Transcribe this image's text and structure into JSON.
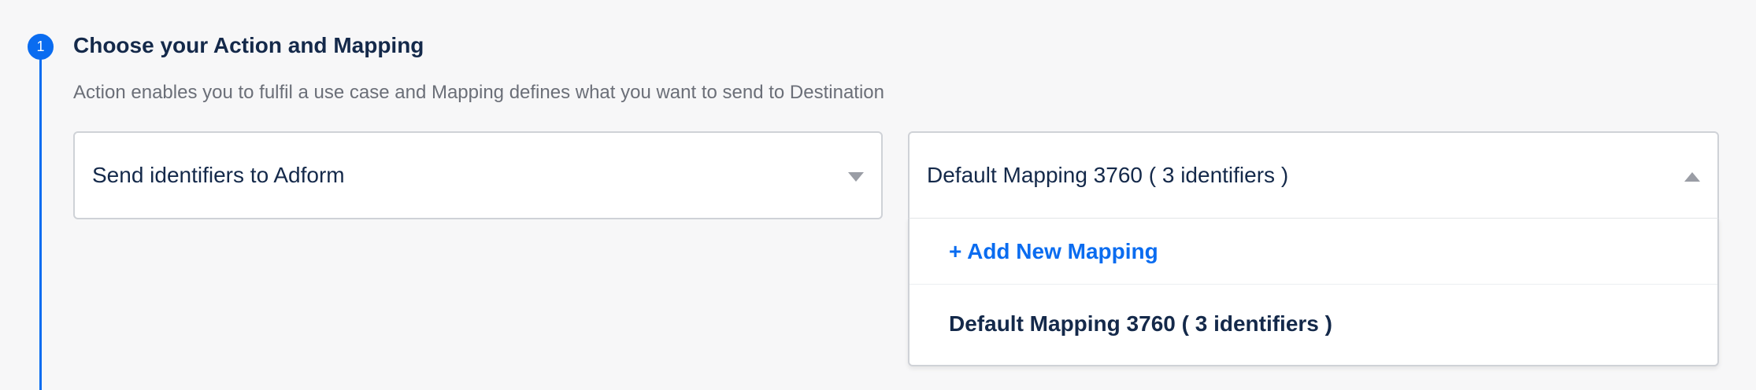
{
  "step": {
    "number": "1",
    "title": "Choose your Action and Mapping",
    "description": "Action enables you to fulfil a use case and Mapping defines what you want to send to Destination"
  },
  "action_select": {
    "value": "Send identifiers to Adform",
    "icon": "chevron-down-icon"
  },
  "mapping_select": {
    "value": "Default Mapping 3760 ( 3 identifiers )",
    "icon": "chevron-up-icon",
    "expanded": true,
    "options": {
      "add_new_label": "+ Add New Mapping",
      "items": [
        {
          "label": "Default Mapping 3760 ( 3 identifiers )"
        }
      ]
    }
  },
  "colors": {
    "accent": "#0a6cf0",
    "text_primary": "#14294a",
    "text_secondary": "#6b6f78",
    "border": "#cfd2d7"
  }
}
